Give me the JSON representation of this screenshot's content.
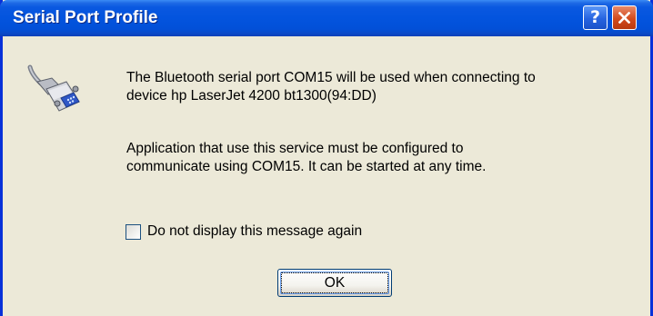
{
  "window": {
    "title": "Serial Port Profile",
    "help_label": "?",
    "close_icon": "close-icon"
  },
  "message": {
    "line1": "The Bluetooth serial port COM15 will be used when connecting to\ndevice hp LaserJet 4200 bt1300(94:DD)",
    "line2": "Application that use this service must be configured to\ncommunicate using COM15.  It can be started at any time."
  },
  "checkbox": {
    "label": "Do not display this message again",
    "checked": false
  },
  "buttons": {
    "ok_label": "OK"
  },
  "icons": {
    "main": "serial-port-connector-icon"
  },
  "colors": {
    "title_bar": "#0354de",
    "window_border": "#0831d9",
    "dialog_bg": "#ece9d8",
    "close_button": "#d24a1c"
  }
}
